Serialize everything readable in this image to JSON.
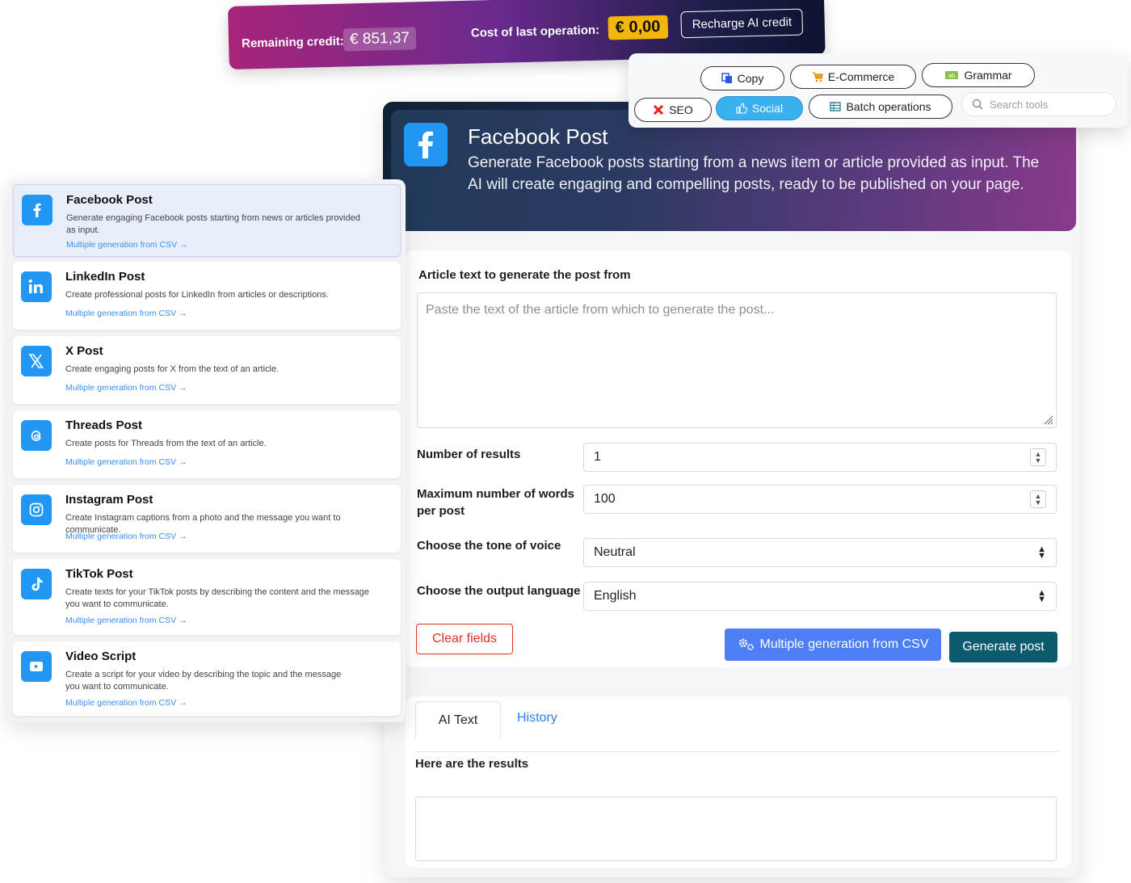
{
  "credit_bar": {
    "remaining_label": "Remaining credit:",
    "remaining_value": "€ 851,37",
    "cost_label": "Cost of last operation:",
    "cost_value": "€ 0,00",
    "recharge_label": "Recharge AI credit"
  },
  "tool_tabs": {
    "copy": "Copy",
    "ecommerce": "E-Commerce",
    "grammar": "Grammar",
    "seo": "SEO",
    "social": "Social",
    "batch": "Batch operations",
    "search_placeholder": "Search tools"
  },
  "hero": {
    "title": "Facebook Post",
    "description": "Generate Facebook posts starting from a news item or article provided as input. The AI will create engaging and compelling posts, ready to be published on your page."
  },
  "form": {
    "article_label": "Article text to generate the post from",
    "article_placeholder": "Paste the text of the article from which to generate the post...",
    "results_count_label": "Number of results",
    "results_count_value": "1",
    "max_words_label": "Maximum number of words per post",
    "max_words_value": "100",
    "tone_label": "Choose the tone of voice",
    "tone_value": "Neutral",
    "language_label": "Choose the output language",
    "language_value": "English",
    "clear_label": "Clear fields",
    "csv_label": "Multiple generation from CSV",
    "generate_label": "Generate post"
  },
  "results": {
    "tab_ai": "AI Text",
    "tab_history": "History",
    "label": "Here are the results"
  },
  "sidebar": {
    "link_label": "Multiple generation from CSV →",
    "items": [
      {
        "title": "Facebook Post",
        "desc": "Generate engaging Facebook posts starting from news or articles provided as input.",
        "icon": "facebook-icon"
      },
      {
        "title": "LinkedIn Post",
        "desc": "Create professional posts for LinkedIn from articles or descriptions.",
        "icon": "linkedin-icon"
      },
      {
        "title": "X Post",
        "desc": "Create engaging posts for X from the text of an article.",
        "icon": "x-icon"
      },
      {
        "title": "Threads Post",
        "desc": "Create posts for Threads from the text of an article.",
        "icon": "threads-icon"
      },
      {
        "title": "Instagram Post",
        "desc": "Create Instagram captions from a photo and the message you want to communicate.",
        "icon": "instagram-icon"
      },
      {
        "title": "TikTok Post",
        "desc": "Create texts for your TikTok posts by describing the content and the message you want to communicate.",
        "icon": "tiktok-icon"
      },
      {
        "title": "Video Script",
        "desc": "Create a script for your video by describing the topic and the message you want to communicate.",
        "icon": "video-icon"
      }
    ]
  },
  "colors": {
    "accent_blue": "#2196f3",
    "social_active": "#3ab0ef",
    "cost_badge": "#f5b60a",
    "clear_red": "#e0302a",
    "generate_teal": "#0c5a6e",
    "csv_blue": "#4c7ff5"
  }
}
